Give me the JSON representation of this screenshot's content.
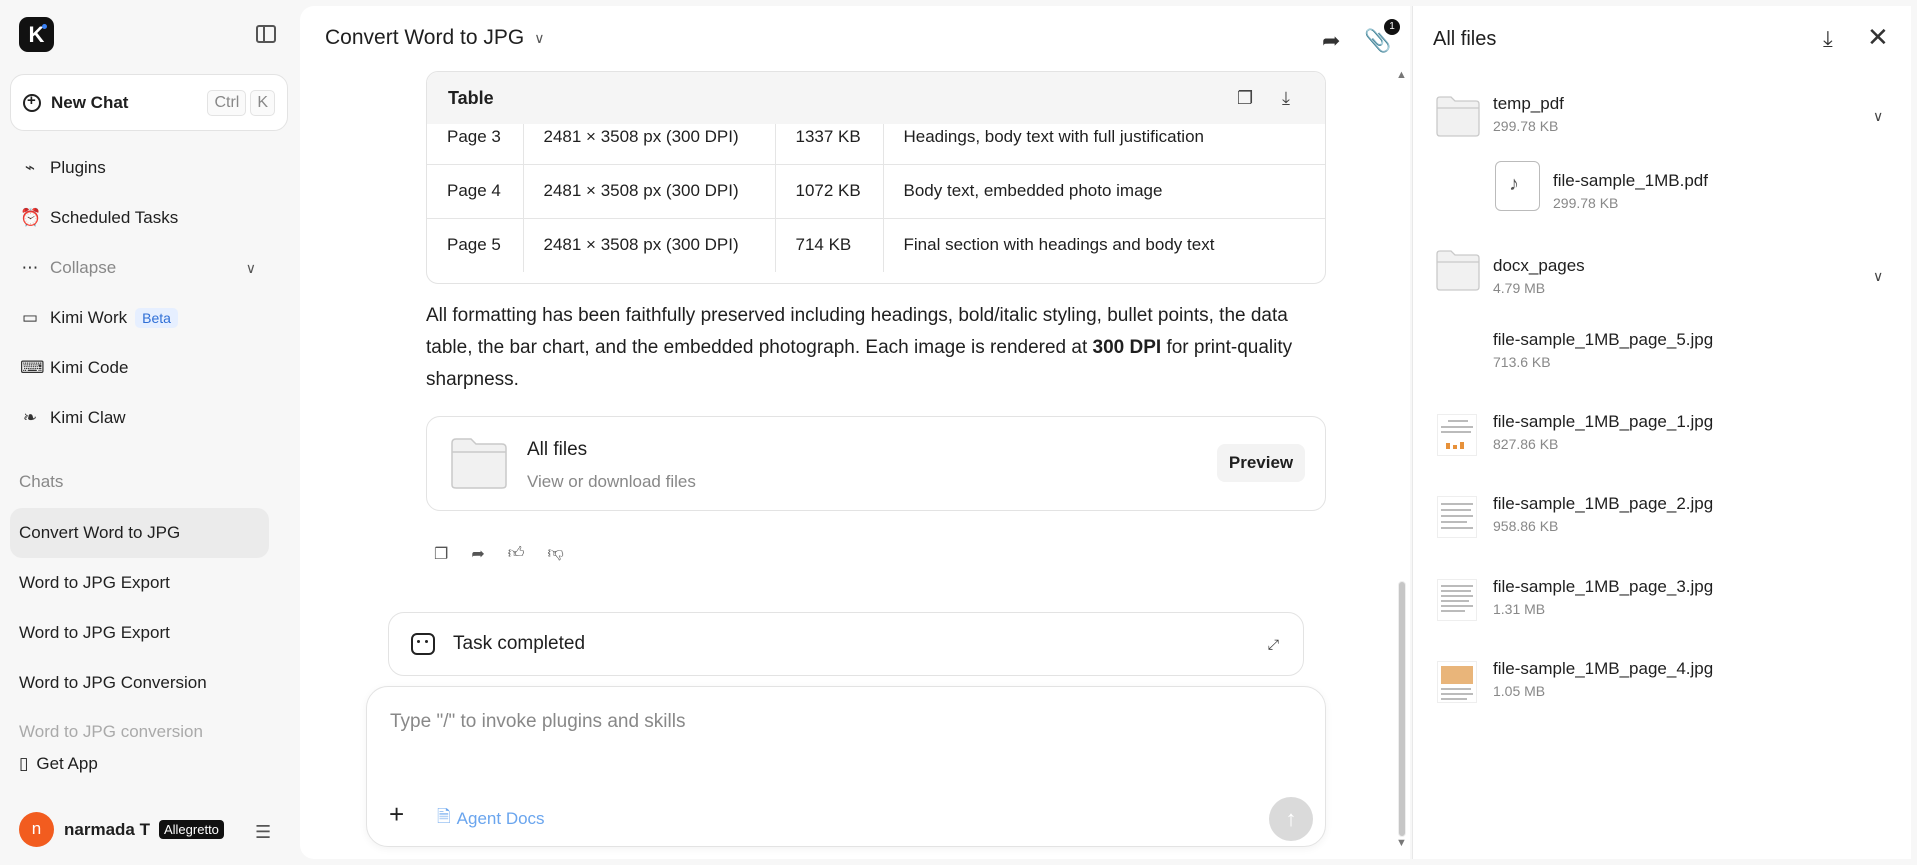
{
  "sidebar": {
    "logo_letter": "K",
    "new_chat": {
      "label": "New Chat",
      "kbd1": "Ctrl",
      "kbd2": "K"
    },
    "nav": [
      {
        "label": "Plugins",
        "icon": "plug-icon"
      },
      {
        "label": "Scheduled Tasks",
        "icon": "alarm-clock-icon"
      },
      {
        "label": "Collapse",
        "icon": "dots-icon"
      },
      {
        "label": "Kimi Work",
        "icon": "monitor-icon",
        "badge": "Beta"
      },
      {
        "label": "Kimi Code",
        "icon": "terminal-icon"
      },
      {
        "label": "Kimi Claw",
        "icon": "claw-icon"
      }
    ],
    "chats_title": "Chats",
    "chats": [
      "Convert Word to JPG",
      "Word to JPG Export",
      "Word to JPG Export",
      "Word to JPG Conversion",
      "Word to JPG conversion"
    ],
    "get_app": "Get App",
    "user": {
      "initial": "n",
      "name": "narmada T",
      "plan": "Allegretto"
    }
  },
  "main": {
    "title": "Convert Word to JPG",
    "attachment_count": "1",
    "table": {
      "title": "Table",
      "rows": [
        [
          "Page 3",
          "2481 × 3508 px (300 DPI)",
          "1337 KB",
          "Headings, body text with full justification"
        ],
        [
          "Page 4",
          "2481 × 3508 px (300 DPI)",
          "1072 KB",
          "Body text, embedded photo image"
        ],
        [
          "Page 5",
          "2481 × 3508 px (300 DPI)",
          "714 KB",
          "Final section with headings and body text"
        ]
      ]
    },
    "paragraph": {
      "before": "All formatting has been faithfully preserved including headings, bold/italic styling, bullet points, the data table, the bar chart, and the embedded photograph. Each image is rendered at ",
      "bold": "300 DPI",
      "after": " for print-quality sharpness."
    },
    "files_card": {
      "title": "All files",
      "subtitle": "View or download files",
      "preview": "Preview"
    },
    "task": {
      "label": "Task completed"
    },
    "input": {
      "placeholder": "Type \"/\" to invoke plugins and skills",
      "agent_docs": "Agent Docs"
    }
  },
  "panel": {
    "title": "All files",
    "items": [
      {
        "kind": "folder",
        "name": "temp_pdf",
        "size": "299.78 KB"
      },
      {
        "kind": "pdf",
        "name": "file-sample_1MB.pdf",
        "size": "299.78 KB"
      },
      {
        "kind": "folder",
        "name": "docx_pages",
        "size": "4.79 MB"
      },
      {
        "kind": "jpg",
        "name": "file-sample_1MB_page_5.jpg",
        "size": "713.6 KB"
      },
      {
        "kind": "jpg",
        "name": "file-sample_1MB_page_1.jpg",
        "size": "827.86 KB"
      },
      {
        "kind": "jpg",
        "name": "file-sample_1MB_page_2.jpg",
        "size": "958.86 KB"
      },
      {
        "kind": "jpg",
        "name": "file-sample_1MB_page_3.jpg",
        "size": "1.31 MB"
      },
      {
        "kind": "jpg",
        "name": "file-sample_1MB_page_4.jpg",
        "size": "1.05 MB"
      }
    ]
  },
  "colors": {
    "avatar": "#f25c1f",
    "beta": "#2f6fd6",
    "agent_docs": "#6aa5ee"
  }
}
